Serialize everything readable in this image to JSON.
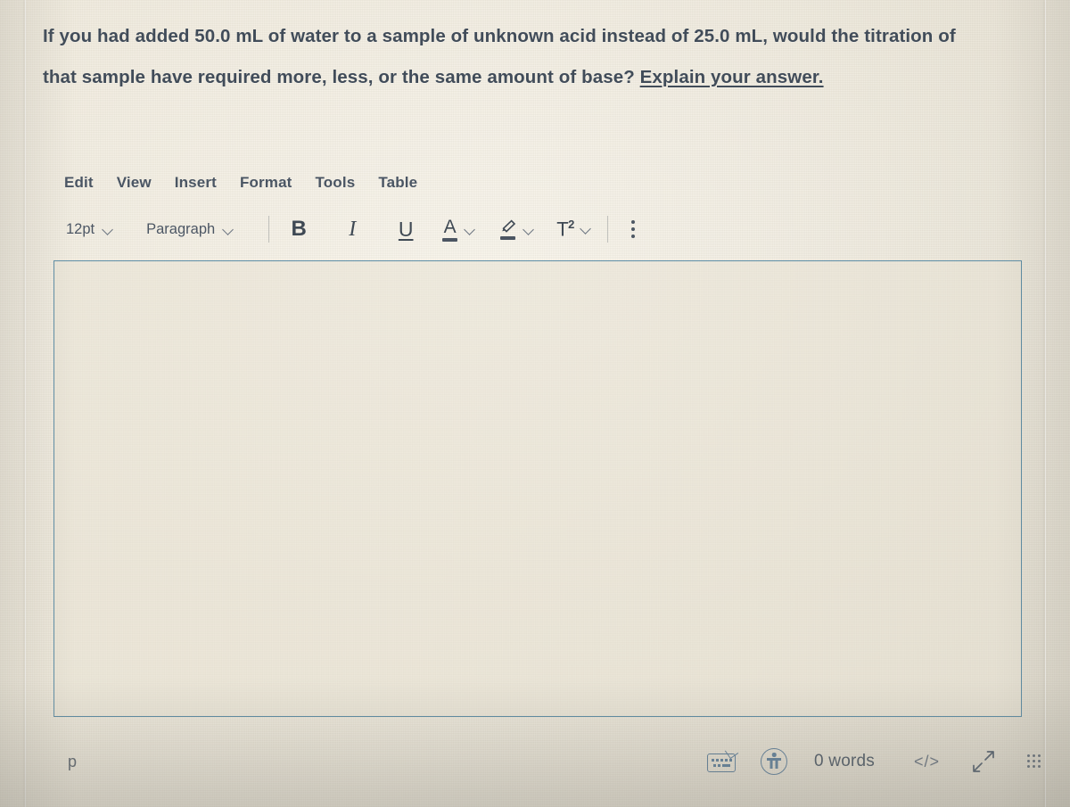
{
  "question": {
    "text_before_link": "If you had added 50.0 mL of water to a sample of unknown acid instead of 25.0 mL, would the titration of that sample have required more, less, or the same amount of base? ",
    "underlined_text": "Explain your answer."
  },
  "editor": {
    "menubar": [
      {
        "label": "Edit",
        "name": "menu-item-edit"
      },
      {
        "label": "View",
        "name": "menu-item-view"
      },
      {
        "label": "Insert",
        "name": "menu-item-insert"
      },
      {
        "label": "Format",
        "name": "menu-item-format"
      },
      {
        "label": "Tools",
        "name": "menu-item-tools"
      },
      {
        "label": "Table",
        "name": "menu-item-table"
      }
    ],
    "toolbar": {
      "font_size": "12pt",
      "block_format": "Paragraph",
      "bold_label": "B",
      "italic_label": "I",
      "underline_label": "U",
      "text_color_label": "A",
      "highlight_icon": "highlighter-pen-icon",
      "superscript_label": "T",
      "superscript_exponent": "2",
      "more_options_icon": "vertical-ellipsis-icon"
    },
    "content": {
      "body_text": "",
      "placeholder": ""
    },
    "statusbar": {
      "element_path": "p",
      "keyboard_icon": "keyboard-shortcuts-icon",
      "accessibility_icon": "accessibility-checker-icon",
      "word_count": "0 words",
      "html_editor_label": "</>",
      "fullscreen_icon": "fullscreen-expand-icon",
      "resize_icon": "resize-grip-icon"
    }
  },
  "colors": {
    "accent_border": "#5b8ba3",
    "text": "#414c59",
    "icon_blue": "#5f7f9a",
    "page_background": "#efe9dc",
    "content_background": "#e8e2d4"
  }
}
